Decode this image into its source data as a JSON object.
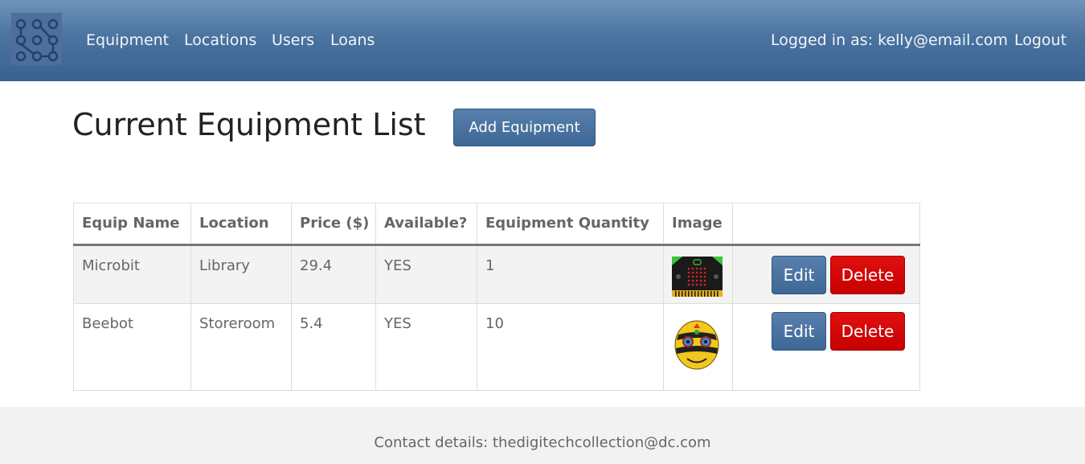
{
  "nav": {
    "logo_icon": "circuit-dots-logo",
    "links": [
      "Equipment",
      "Locations",
      "Users",
      "Loans"
    ],
    "logged_in": "Logged in as: kelly@email.com",
    "logout": "Logout"
  },
  "main": {
    "title": "Current Equipment List",
    "add_button": "Add Equipment"
  },
  "table": {
    "headers": [
      "Equip Name",
      "Location",
      "Price ($)",
      "Available?",
      "Equipment Quantity",
      "Image",
      ""
    ],
    "rows": [
      {
        "name": "Microbit",
        "location": "Library",
        "price": "29.4",
        "available": "YES",
        "quantity": "1",
        "image_icon": "microbit-image",
        "edit": "Edit",
        "delete": "Delete"
      },
      {
        "name": "Beebot",
        "location": "Storeroom",
        "price": "5.4",
        "available": "YES",
        "quantity": "10",
        "image_icon": "beebot-image",
        "edit": "Edit",
        "delete": "Delete"
      }
    ]
  },
  "footer": {
    "contact": "Contact details: thedigitechcollection@dc.com"
  },
  "colors": {
    "navbar": "#4a73a0",
    "primary_button": "#3d6795",
    "danger_button": "#c70000",
    "footer_bg": "#f2f2f2"
  }
}
